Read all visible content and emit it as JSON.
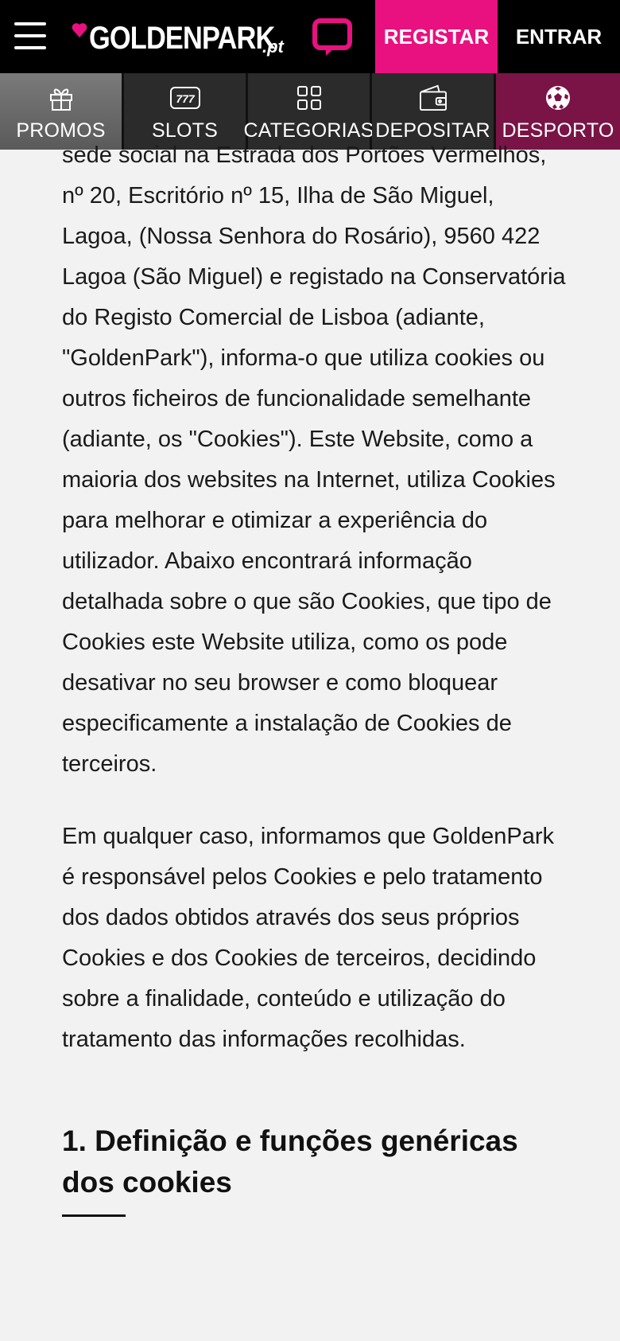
{
  "header": {
    "logo_name": "GOLDENPARK",
    "logo_tld": ".pt",
    "register_label": "REGISTAR",
    "login_label": "ENTRAR",
    "colors": {
      "accent": "#e8117f",
      "background": "#000000"
    },
    "icons": [
      "hamburger-menu-icon",
      "chat-icon"
    ]
  },
  "nav": {
    "items": [
      {
        "label": "PROMOS",
        "icon": "gift-icon"
      },
      {
        "label": "SLOTS",
        "icon": "slots-777-icon"
      },
      {
        "label": "CATEGORIAS",
        "icon": "grid-icon"
      },
      {
        "label": "DEPOSITAR",
        "icon": "wallet-icon"
      },
      {
        "label": "DESPORTO",
        "icon": "soccer-ball-icon"
      }
    ]
  },
  "content": {
    "para1": "sede social na Estrada dos Portões Vermelhos, nº 20, Escritório nº 15, Ilha de São Miguel, Lagoa, (Nossa Senhora do Rosário), 9560 422 Lagoa (São Miguel) e registado na Conservatória do Registo Comercial de Lisboa (adiante, \"GoldenPark\"), informa-o que utiliza cookies ou outros ficheiros de funcionalidade semelhante (adiante, os \"Cookies\"). Este Website, como a maioria dos websites na Internet, utiliza Cookies para melhorar e otimizar a experiência do utilizador. Abaixo encontrará informação detalhada sobre o que são Cookies, que tipo de Cookies este Website utiliza, como os pode desativar no seu browser e como bloquear especificamente a instalação de Cookies de terceiros.",
    "para2": "Em qualquer caso, informamos que GoldenPark é responsável pelos Cookies e pelo tratamento dos dados obtidos através dos seus próprios Cookies e dos Cookies de terceiros, decidindo sobre a finalidade, conteúdo e utilização do tratamento das informações recolhidas.",
    "heading1": "1. Definição e funções genéricas dos cookies"
  }
}
